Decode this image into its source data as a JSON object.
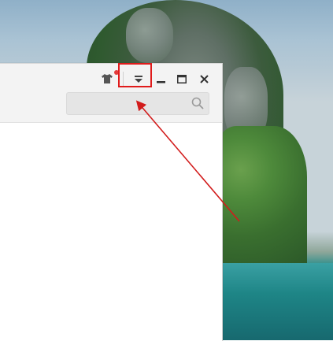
{
  "window": {
    "title_controls": {
      "skin_icon": "shirt-icon",
      "menu_icon": "dropdown-menu-icon",
      "minimize_icon": "minimize-icon",
      "maximize_icon": "maximize-icon",
      "close_icon": "close-icon"
    },
    "search": {
      "placeholder": "",
      "value": "",
      "icon": "search-icon"
    }
  },
  "annotation": {
    "highlight": "menu-button",
    "arrow_color": "#d21c1c"
  },
  "colors": {
    "titlebar_bg": "#f3f3f3",
    "search_bg": "#e5e5e5",
    "notification": "#e33b3b",
    "highlight": "#e01b1b"
  }
}
